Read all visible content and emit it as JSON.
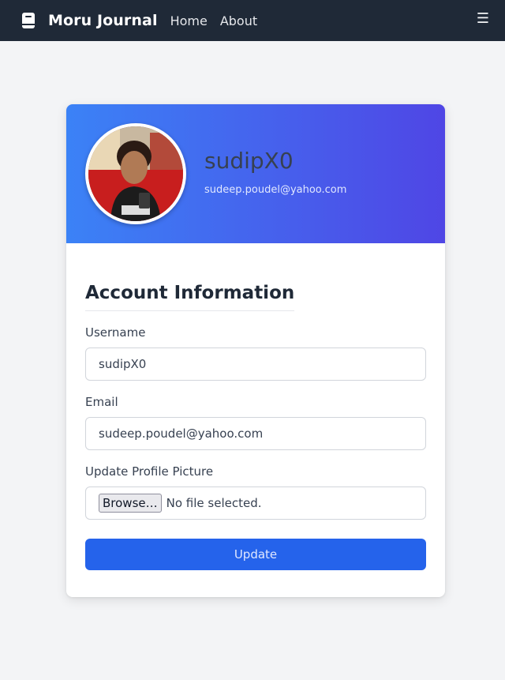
{
  "nav": {
    "brand": "Moru Journal",
    "links": [
      "Home",
      "About"
    ],
    "menu_icon": "hamburger-icon"
  },
  "profile": {
    "username": "sudipX0",
    "email": "sudeep.poudel@yahoo.com"
  },
  "form": {
    "title": "Account Information",
    "username_label": "Username",
    "username_value": "sudipX0",
    "email_label": "Email",
    "email_value": "sudeep.poudel@yahoo.com",
    "picture_label": "Update Profile Picture",
    "browse_label": "Browse…",
    "file_status": "No file selected.",
    "submit_label": "Update"
  },
  "colors": {
    "navbar": "#1f2937",
    "header_gradient_start": "#3b82f6",
    "header_gradient_end": "#4f46e5",
    "primary_button": "#2563eb"
  }
}
